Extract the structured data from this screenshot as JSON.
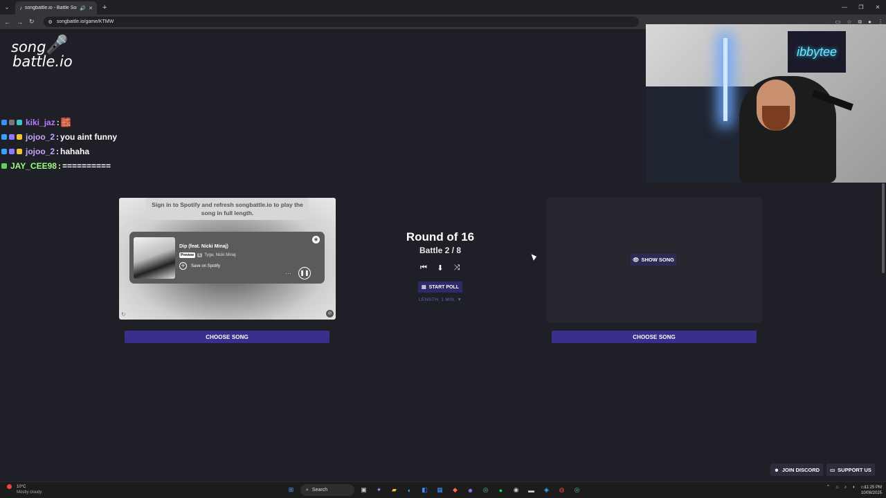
{
  "browser": {
    "tab_title": "songbattle.io - Battle Song",
    "url": "songbattle.io/game/KTMW"
  },
  "logo": {
    "line1": "song",
    "line2": "battle.io"
  },
  "chat": [
    {
      "user": "kiki_jaz",
      "message": "",
      "color": "#b57cff",
      "emote": "🧱"
    },
    {
      "user": "jojoo_2",
      "message": "you aint funny",
      "color": "#c9a6ff"
    },
    {
      "user": "jojoo_2",
      "message": "hahaha",
      "color": "#c9a6ff"
    },
    {
      "user": "JAY_CEE98",
      "message": "==========",
      "color": "#9aff7a"
    }
  ],
  "chat_separator": ":",
  "webcam": {
    "sign_text": "ibbytee"
  },
  "left_card": {
    "signin_text": "Sign in to Spotify and refresh songbattle.io to play the song in full length.",
    "song_title": "Dip (feat. Nicki Minaj)",
    "preview_label": "Preview",
    "explicit_label": "E",
    "artists": "Tyga, Nicki Minaj",
    "save_label": "Save on Spotify",
    "choose_label": "CHOOSE SONG"
  },
  "right_card": {
    "show_label": "SHOW SONG",
    "choose_label": "CHOOSE SONG"
  },
  "center": {
    "round": "Round of 16",
    "battle": "Battle 2 / 8",
    "start_poll": "START POLL",
    "length": "LENGTH: 1 MIN. ▼"
  },
  "footer": {
    "discord": "JOIN DISCORD",
    "support": "SUPPORT US"
  },
  "taskbar": {
    "weather_temp": "10°C",
    "weather_desc": "Mostly cloudy",
    "search_placeholder": "Search",
    "time": "11:25 PM",
    "date": "10/08/2025"
  },
  "colors": {
    "accent": "#3a2f8c",
    "background": "#1f1f27"
  }
}
